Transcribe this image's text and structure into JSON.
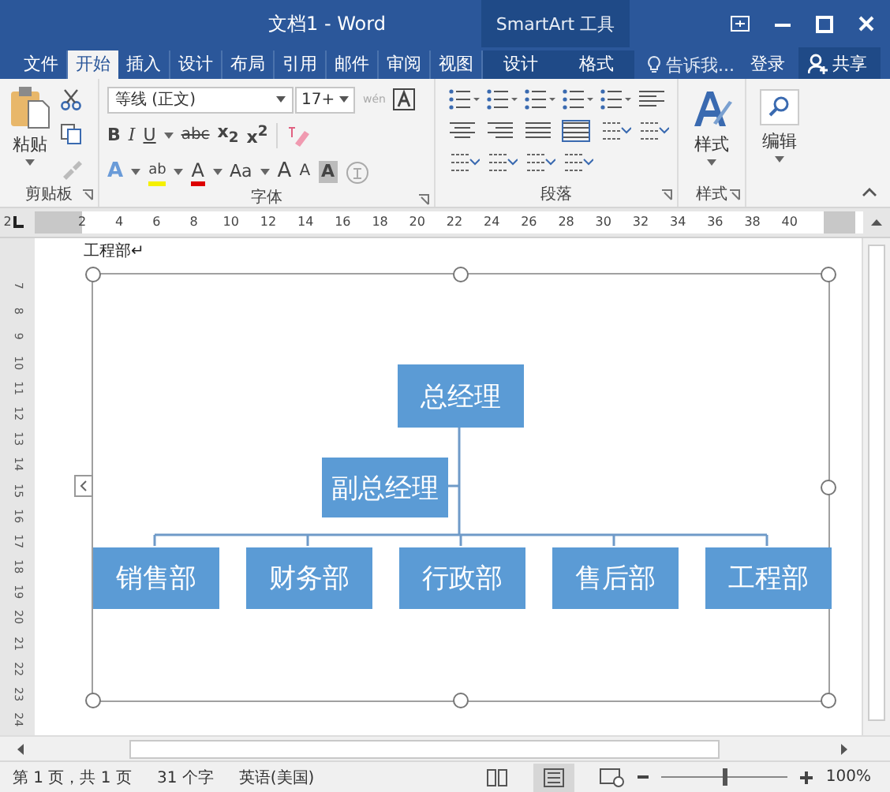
{
  "title_bar": {
    "title": "文档1 - Word",
    "context_title": "SmartArt 工具"
  },
  "tabs": [
    {
      "label": "文件",
      "selected": false,
      "contextual": false
    },
    {
      "label": "开始",
      "selected": true,
      "contextual": false
    },
    {
      "label": "插入",
      "selected": false,
      "contextual": false
    },
    {
      "label": "设计",
      "selected": false,
      "contextual": false
    },
    {
      "label": "布局",
      "selected": false,
      "contextual": false
    },
    {
      "label": "引用",
      "selected": false,
      "contextual": false
    },
    {
      "label": "邮件",
      "selected": false,
      "contextual": false
    },
    {
      "label": "审阅",
      "selected": false,
      "contextual": false
    },
    {
      "label": "视图",
      "selected": false,
      "contextual": false
    },
    {
      "label": "设计",
      "selected": false,
      "contextual": true
    },
    {
      "label": "格式",
      "selected": false,
      "contextual": true
    }
  ],
  "tell_me": "告诉我...",
  "sign_in": "登录",
  "share": "共享",
  "ribbon": {
    "clipboard": {
      "paste": "粘贴",
      "label": "剪贴板"
    },
    "font": {
      "name": "等线 (正文)",
      "size": "17+",
      "phonetic": "wén",
      "label": "字体",
      "row1": [
        {
          "kind": "bold",
          "label": "B"
        },
        {
          "kind": "italic",
          "label": "I"
        },
        {
          "kind": "underline",
          "label": "U"
        },
        {
          "kind": "strike",
          "label": "abc"
        },
        {
          "kind": "sub",
          "label": "x$_{2}$"
        },
        {
          "kind": "sup",
          "label": "x$^{2}$"
        }
      ],
      "row2": [
        {
          "kind": "effect",
          "label": "A"
        },
        {
          "kind": "highlight",
          "label": "ab"
        },
        {
          "kind": "color",
          "label": "A"
        },
        {
          "kind": "case",
          "label": "Aa"
        },
        {
          "kind": "grow",
          "label": "A"
        },
        {
          "kind": "shrink",
          "label": "A"
        },
        {
          "kind": "shade",
          "label": "A"
        }
      ]
    },
    "paragraph": {
      "label": "段落"
    },
    "styles": {
      "button": "样式",
      "label": "样式"
    },
    "editing": {
      "button": "编辑"
    }
  },
  "ruler": {
    "numbers": [
      "2",
      "2",
      "4",
      "6",
      "8",
      "10",
      "12",
      "14",
      "16",
      "18",
      "20",
      "22",
      "24",
      "26",
      "28",
      "30",
      "32",
      "34",
      "36",
      "38",
      "40"
    ],
    "vertical": [
      "7",
      "8",
      "9",
      "10",
      "11",
      "12",
      "13",
      "14",
      "15",
      "16",
      "17",
      "18",
      "19",
      "20",
      "21",
      "22",
      "23",
      "24"
    ]
  },
  "document": {
    "text": "工程部↵",
    "org_chart": {
      "top": "总经理",
      "assistant": "副总经理",
      "departments": [
        "销售部",
        "财务部",
        "行政部",
        "售后部",
        "工程部"
      ]
    }
  },
  "status_bar": {
    "page": "第 1 页，共 1 页",
    "words": "31 个字",
    "language": "英语(美国)",
    "zoom_slider": {
      "level": 0.5
    },
    "zoom": "100%"
  }
}
